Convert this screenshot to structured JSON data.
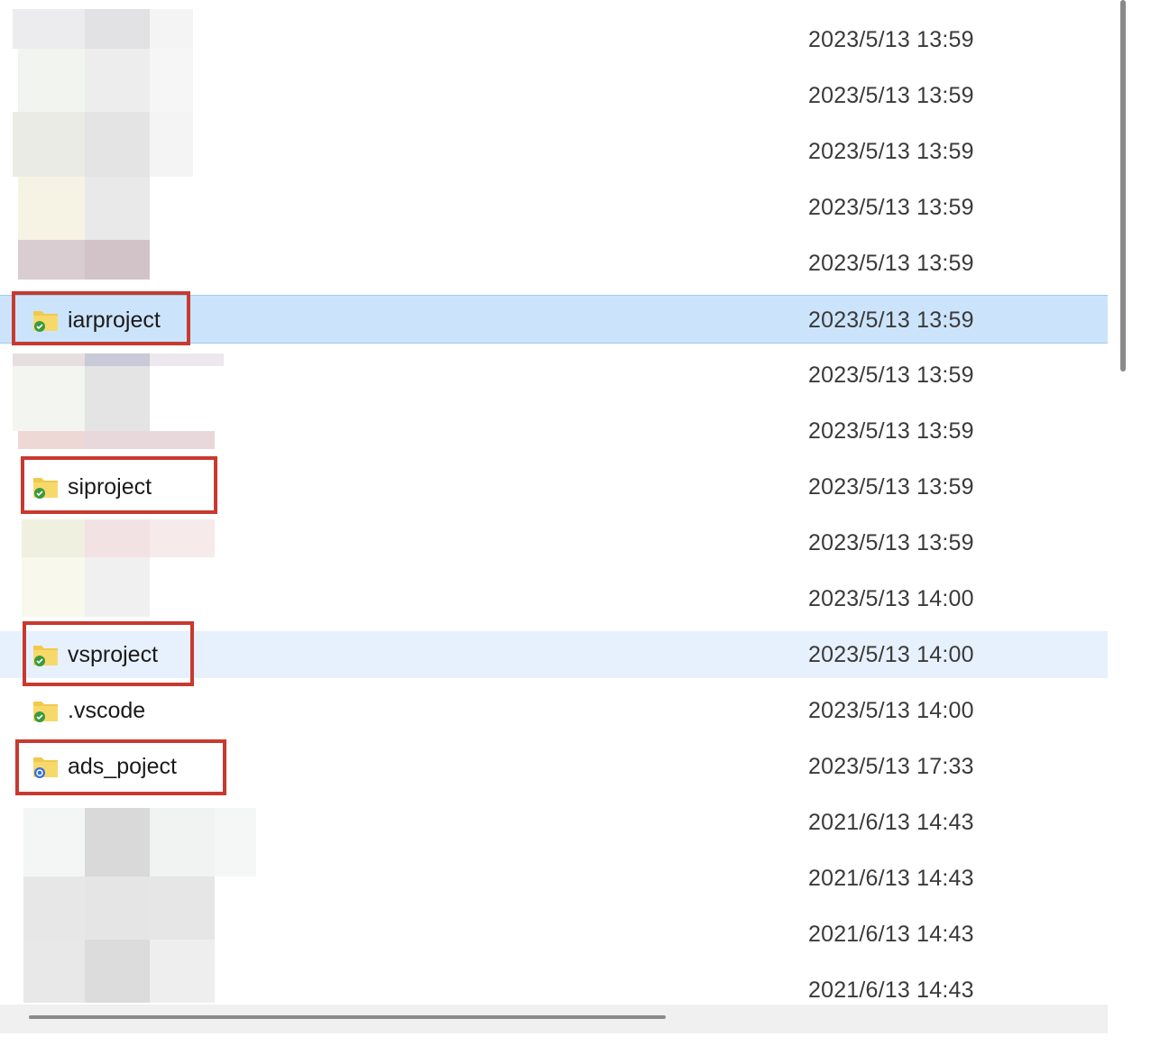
{
  "rows": [
    {
      "name": "",
      "date": "2023/5/13 13:59"
    },
    {
      "name": "",
      "date": "2023/5/13 13:59"
    },
    {
      "name": "",
      "date": "2023/5/13 13:59"
    },
    {
      "name": "",
      "date": "2023/5/13 13:59"
    },
    {
      "name": "",
      "date": "2023/5/13 13:59"
    },
    {
      "name": "iarproject",
      "date": "2023/5/13 13:59"
    },
    {
      "name": "",
      "date": "2023/5/13 13:59"
    },
    {
      "name": "",
      "date": "2023/5/13 13:59"
    },
    {
      "name": "siproject",
      "date": "2023/5/13 13:59"
    },
    {
      "name": "",
      "date": "2023/5/13 13:59"
    },
    {
      "name": "",
      "date": "2023/5/13 14:00"
    },
    {
      "name": "vsproject",
      "date": "2023/5/13 14:00"
    },
    {
      "name": ".vscode",
      "date": "2023/5/13 14:00"
    },
    {
      "name": "ads_poject",
      "date": "2023/5/13 17:33"
    },
    {
      "name": "",
      "date": "2021/6/13 14:43"
    },
    {
      "name": "",
      "date": "2021/6/13 14:43"
    },
    {
      "name": "",
      "date": "2021/6/13 14:43"
    },
    {
      "name": "",
      "date": "2021/6/13 14:43"
    }
  ],
  "icons": {
    "folder_sync_ok": "folder-sync-ok-icon",
    "folder_sync_pending": "folder-sync-pending-icon"
  },
  "colors": {
    "selection": "#cce4fb",
    "hover": "#e6f1fd",
    "highlight_box": "#c8392f",
    "sync_ok": "#3a9a3e",
    "sync_pending": "#3b6fd6",
    "folder": "#f2c94c"
  }
}
